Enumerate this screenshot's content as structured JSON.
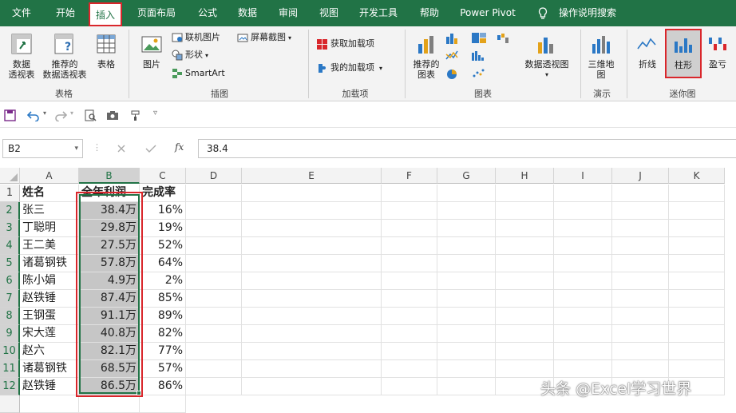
{
  "tabs": [
    "文件",
    "开始",
    "插入",
    "页面布局",
    "公式",
    "数据",
    "审阅",
    "视图",
    "开发工具",
    "帮助",
    "Power Pivot",
    "操作说明搜索"
  ],
  "ribbon": {
    "tables": {
      "pivot": "数据\n透视表",
      "recommended_pivot": "推荐的\n数据透视表",
      "table": "表格",
      "label": "表格"
    },
    "illustrations": {
      "pictures": "图片",
      "online_pictures": "联机图片",
      "shapes": "形状",
      "smartart": "SmartArt",
      "screenshot": "屏幕截图",
      "label": "插图"
    },
    "addins": {
      "get": "获取加载项",
      "my": "我的加载项",
      "label": "加载项"
    },
    "charts": {
      "recommended": "推荐的\n图表",
      "pivot_chart": "数据透视图",
      "label": "图表"
    },
    "tours": {
      "map3d": "三维地\n图",
      "label": "演示"
    },
    "sparklines": {
      "line": "折线",
      "column": "柱形",
      "winloss": "盈亏",
      "label": "迷你图"
    }
  },
  "formula_bar": {
    "name_box": "B2",
    "fx": "fx",
    "value": "38.4"
  },
  "columns": [
    "A",
    "B",
    "C",
    "D",
    "E",
    "F",
    "G",
    "H",
    "I",
    "J",
    "K"
  ],
  "rows": [
    "1",
    "2",
    "3",
    "4",
    "5",
    "6",
    "7",
    "8",
    "9",
    "10",
    "11",
    "12"
  ],
  "sheet": {
    "headers": [
      "姓名",
      "全年利润",
      "完成率"
    ],
    "data": [
      [
        "张三",
        "38.4万",
        "16%"
      ],
      [
        "丁聪明",
        "29.8万",
        "19%"
      ],
      [
        "王二美",
        "27.5万",
        "52%"
      ],
      [
        "诸葛钢铁",
        "57.8万",
        "64%"
      ],
      [
        "陈小娟",
        "4.9万",
        "2%"
      ],
      [
        "赵铁锤",
        "87.4万",
        "85%"
      ],
      [
        "王钢蛋",
        "91.1万",
        "89%"
      ],
      [
        "宋大莲",
        "40.8万",
        "82%"
      ],
      [
        "赵六",
        "82.1万",
        "77%"
      ],
      [
        "诸葛钢铁",
        "68.5万",
        "57%"
      ],
      [
        "赵铁锤",
        "86.5万",
        "86%"
      ]
    ]
  },
  "watermark": "头条 @Excel学习世界",
  "colors": {
    "accent": "#217346",
    "highlight": "#d9262b"
  }
}
